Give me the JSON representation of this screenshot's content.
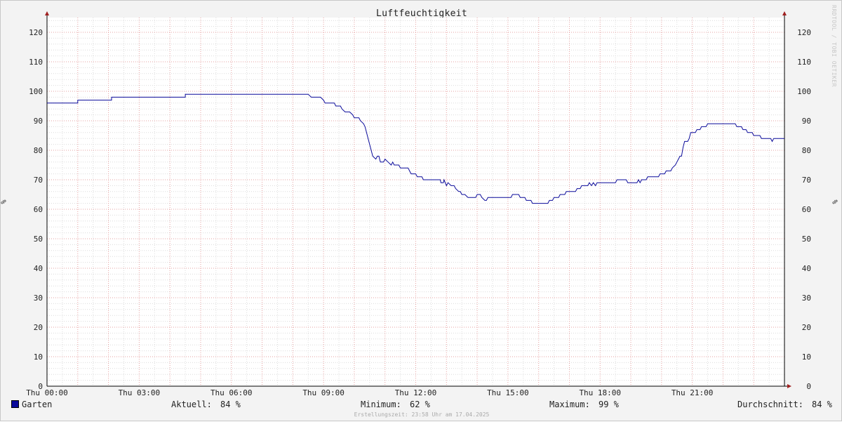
{
  "chart_data": {
    "type": "line",
    "title": "Luftfeuchtigkeit",
    "ylabel": "%",
    "ylim": [
      0,
      125
    ],
    "y_ticks": [
      0,
      10,
      20,
      30,
      40,
      50,
      60,
      70,
      80,
      90,
      100,
      110,
      120
    ],
    "x_unit": "hours since Thu 00:00",
    "xlim": [
      0,
      24
    ],
    "x_ticks": [
      {
        "x": 0,
        "label": "Thu 00:00"
      },
      {
        "x": 3,
        "label": "Thu 03:00"
      },
      {
        "x": 6,
        "label": "Thu 06:00"
      },
      {
        "x": 9,
        "label": "Thu 09:00"
      },
      {
        "x": 12,
        "label": "Thu 12:00"
      },
      {
        "x": 15,
        "label": "Thu 15:00"
      },
      {
        "x": 18,
        "label": "Thu 18:00"
      },
      {
        "x": 21,
        "label": "Thu 21:00"
      }
    ],
    "grid": true,
    "series": [
      {
        "name": "Garten",
        "color": "#0a0a9a",
        "points": [
          [
            0.0,
            96
          ],
          [
            1.0,
            96
          ],
          [
            1.0,
            97
          ],
          [
            2.1,
            97
          ],
          [
            2.1,
            98
          ],
          [
            4.5,
            98
          ],
          [
            4.5,
            99
          ],
          [
            8.5,
            99
          ],
          [
            8.6,
            98
          ],
          [
            8.9,
            98
          ],
          [
            9.0,
            97
          ],
          [
            9.05,
            96
          ],
          [
            9.35,
            96
          ],
          [
            9.4,
            95
          ],
          [
            9.55,
            95
          ],
          [
            9.6,
            94
          ],
          [
            9.7,
            93
          ],
          [
            9.85,
            93
          ],
          [
            9.95,
            92
          ],
          [
            10.0,
            91
          ],
          [
            10.15,
            91
          ],
          [
            10.2,
            90
          ],
          [
            10.3,
            89
          ],
          [
            10.35,
            88
          ],
          [
            10.4,
            86
          ],
          [
            10.45,
            84
          ],
          [
            10.5,
            82
          ],
          [
            10.55,
            80
          ],
          [
            10.6,
            78
          ],
          [
            10.7,
            77
          ],
          [
            10.75,
            78
          ],
          [
            10.8,
            78
          ],
          [
            10.85,
            76
          ],
          [
            10.95,
            76
          ],
          [
            11.0,
            77
          ],
          [
            11.1,
            76
          ],
          [
            11.2,
            75
          ],
          [
            11.25,
            76
          ],
          [
            11.3,
            75
          ],
          [
            11.45,
            75
          ],
          [
            11.5,
            74
          ],
          [
            11.75,
            74
          ],
          [
            11.8,
            73
          ],
          [
            11.85,
            72
          ],
          [
            12.0,
            72
          ],
          [
            12.05,
            71
          ],
          [
            12.2,
            71
          ],
          [
            12.25,
            70
          ],
          [
            12.8,
            70
          ],
          [
            12.82,
            69
          ],
          [
            12.9,
            69
          ],
          [
            12.92,
            70
          ],
          [
            13.0,
            68
          ],
          [
            13.05,
            69
          ],
          [
            13.15,
            68
          ],
          [
            13.25,
            68
          ],
          [
            13.3,
            67
          ],
          [
            13.4,
            66
          ],
          [
            13.45,
            66
          ],
          [
            13.5,
            65
          ],
          [
            13.6,
            65
          ],
          [
            13.7,
            64
          ],
          [
            13.95,
            64
          ],
          [
            14.0,
            65
          ],
          [
            14.1,
            65
          ],
          [
            14.15,
            64
          ],
          [
            14.25,
            63
          ],
          [
            14.3,
            63
          ],
          [
            14.35,
            64
          ],
          [
            15.1,
            64
          ],
          [
            15.15,
            65
          ],
          [
            15.35,
            65
          ],
          [
            15.4,
            64
          ],
          [
            15.55,
            64
          ],
          [
            15.6,
            63
          ],
          [
            15.75,
            63
          ],
          [
            15.8,
            62
          ],
          [
            16.3,
            62
          ],
          [
            16.35,
            63
          ],
          [
            16.45,
            63
          ],
          [
            16.5,
            64
          ],
          [
            16.65,
            64
          ],
          [
            16.7,
            65
          ],
          [
            16.85,
            65
          ],
          [
            16.9,
            66
          ],
          [
            17.2,
            66
          ],
          [
            17.25,
            67
          ],
          [
            17.35,
            67
          ],
          [
            17.4,
            68
          ],
          [
            17.6,
            68
          ],
          [
            17.65,
            69
          ],
          [
            17.72,
            68
          ],
          [
            17.78,
            69
          ],
          [
            17.85,
            68
          ],
          [
            17.9,
            69
          ],
          [
            18.5,
            69
          ],
          [
            18.55,
            70
          ],
          [
            18.85,
            70
          ],
          [
            18.9,
            69
          ],
          [
            19.2,
            69
          ],
          [
            19.25,
            70
          ],
          [
            19.3,
            69
          ],
          [
            19.35,
            70
          ],
          [
            19.5,
            70
          ],
          [
            19.55,
            71
          ],
          [
            19.9,
            71
          ],
          [
            19.95,
            72
          ],
          [
            20.1,
            72
          ],
          [
            20.15,
            73
          ],
          [
            20.3,
            73
          ],
          [
            20.35,
            74
          ],
          [
            20.45,
            75
          ],
          [
            20.5,
            76
          ],
          [
            20.55,
            77
          ],
          [
            20.6,
            78
          ],
          [
            20.65,
            78
          ],
          [
            20.7,
            81
          ],
          [
            20.75,
            83
          ],
          [
            20.85,
            83
          ],
          [
            20.9,
            84
          ],
          [
            20.95,
            86
          ],
          [
            21.1,
            86
          ],
          [
            21.15,
            87
          ],
          [
            21.25,
            87
          ],
          [
            21.3,
            88
          ],
          [
            21.45,
            88
          ],
          [
            21.5,
            89
          ],
          [
            22.4,
            89
          ],
          [
            22.45,
            88
          ],
          [
            22.6,
            88
          ],
          [
            22.65,
            87
          ],
          [
            22.75,
            87
          ],
          [
            22.8,
            86
          ],
          [
            22.95,
            86
          ],
          [
            23.0,
            85
          ],
          [
            23.2,
            85
          ],
          [
            23.25,
            84
          ],
          [
            23.55,
            84
          ],
          [
            23.6,
            83
          ],
          [
            23.65,
            84
          ],
          [
            24.0,
            84
          ]
        ]
      }
    ]
  },
  "legend": {
    "series_name": "Garten",
    "series_color": "#0a0a9a",
    "current_label": "Aktuell:",
    "current_value": "84 %",
    "min_label": "Minimum:",
    "min_value": "62 %",
    "max_label": "Maximum:",
    "max_value": "99 %",
    "avg_label": "Durchschnitt:",
    "avg_value": "84 %"
  },
  "watermark": "RRDTOOL / TOBI OETIKER",
  "footer": "Erstellungszeit: 23:58 Uhr am 17.04.2025"
}
